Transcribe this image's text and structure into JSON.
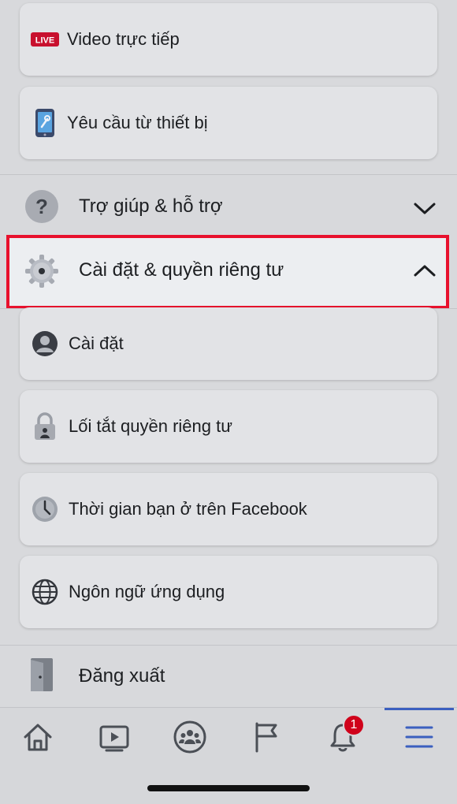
{
  "top_items": [
    {
      "label": "Video trực tiếp",
      "icon": "live-icon",
      "badge_text": "LIVE"
    },
    {
      "label": "Yêu cầu từ thiết bị",
      "icon": "device-request-icon"
    }
  ],
  "help_section": {
    "label": "Trợ giúp & hỗ trợ",
    "icon": "question-icon",
    "chevron": "chevron-down-icon"
  },
  "settings_section": {
    "label": "Cài đặt & quyền riêng tư",
    "icon": "gear-icon",
    "chevron": "chevron-up-icon",
    "highlight_color": "#e8112d"
  },
  "settings_items": [
    {
      "label": "Cài đặt",
      "icon": "profile-icon"
    },
    {
      "label": "Lối tắt quyền riêng tư",
      "icon": "lock-icon"
    },
    {
      "label": "Thời gian bạn ở trên Facebook",
      "icon": "clock-icon"
    },
    {
      "label": "Ngôn ngữ ứng dụng",
      "icon": "globe-icon"
    }
  ],
  "logout": {
    "label": "Đăng xuất",
    "icon": "door-icon"
  },
  "tabbar": {
    "tabs": [
      "home-icon",
      "video-icon",
      "groups-icon",
      "flag-icon",
      "bell-icon",
      "menu-icon"
    ],
    "notification_count": "1",
    "active_color": "#3b5fbf"
  }
}
